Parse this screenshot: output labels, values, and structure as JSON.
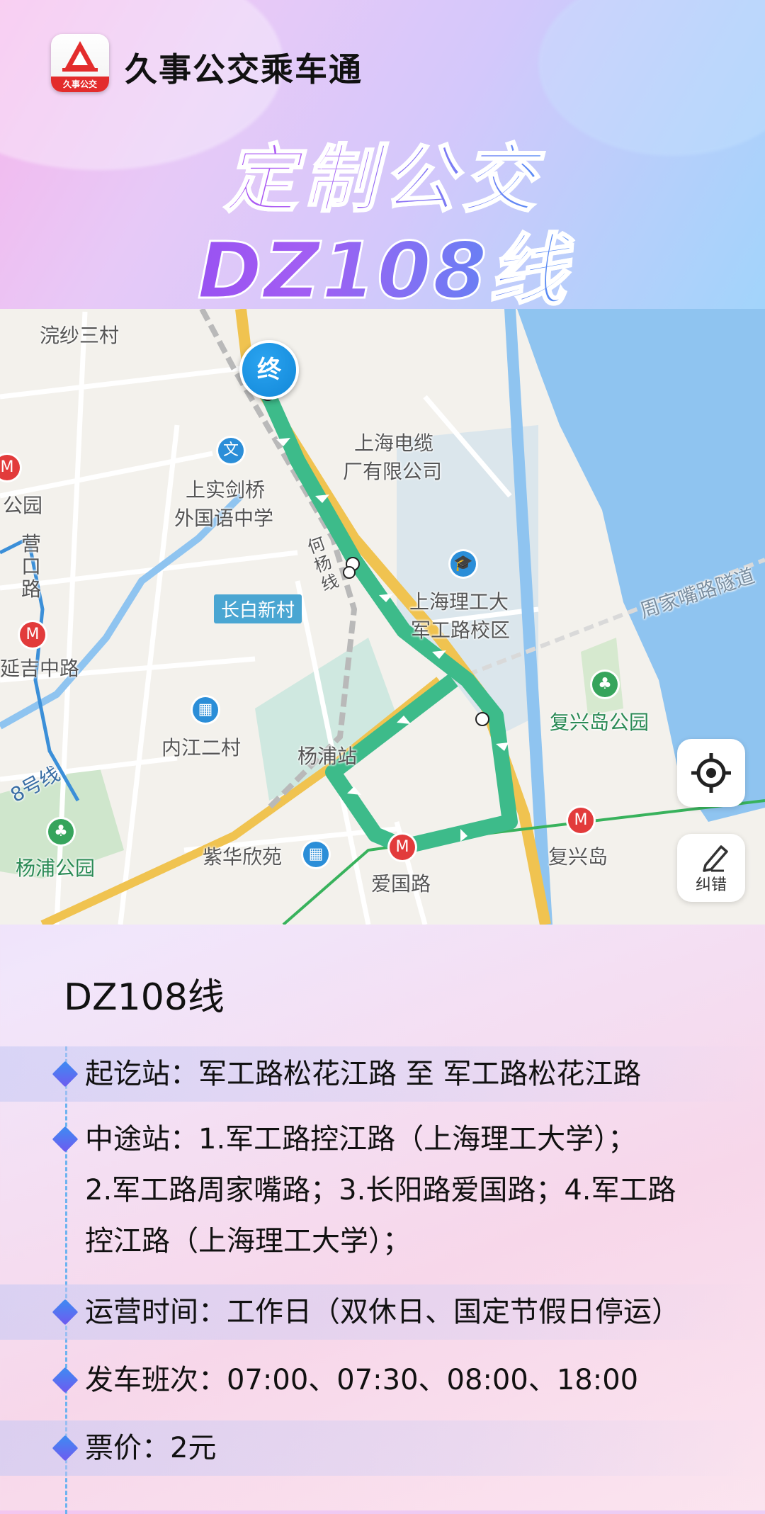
{
  "header": {
    "app_name": "久事公交乘车通",
    "logo_text": "久事公交",
    "hero_line1": "定制公交",
    "hero_line2": "DZ108线"
  },
  "map": {
    "labels": {
      "wanshasancun": "浣纱三村",
      "cable_company_1": "上海电缆",
      "cable_company_2": "厂有限公司",
      "shangshi_1": "上实剑桥",
      "shangshi_2": "外国语中学",
      "gongyuan": "公园",
      "yingkou": "营口路",
      "changbai": "长白新村",
      "usst_1": "上海理工大",
      "usst_2": "军工路校区",
      "yanji": "延吉中路",
      "fuxingdao_park": "复兴岛公园",
      "neijiang": "内江二村",
      "yangpu_station": "杨浦站",
      "zihua": "紫华欣苑",
      "aiguo": "爱国路",
      "fuxingdao": "复兴岛",
      "yangpu_park": "杨浦公园",
      "line8": "8号线",
      "tunnel": "周家嘴路隧道",
      "heyang": "何杨线"
    },
    "end_marker": "终",
    "report_button": "纠错",
    "colors": {
      "route": "#3dbb8a",
      "river": "#8fc4f0",
      "highway": "#f0c350",
      "metro_line": "#3b8fd8",
      "green_line": "#38b25c"
    }
  },
  "info": {
    "title": "DZ108线",
    "start_end": "起讫站：军工路松花江路 至 军工路松花江路",
    "midway_line1": "中途站：1.军工路控江路（上海理工大学）；",
    "midway_line2": "2.军工路周家嘴路；3.长阳路爱国路；4.军工路",
    "midway_line3": "控江路（上海理工大学）；",
    "hours": "运营时间：工作日（双休日、国定节假日停运）",
    "departures": "发车班次：07:00、07:30、08:00、18:00",
    "fare": "票价：2元"
  }
}
